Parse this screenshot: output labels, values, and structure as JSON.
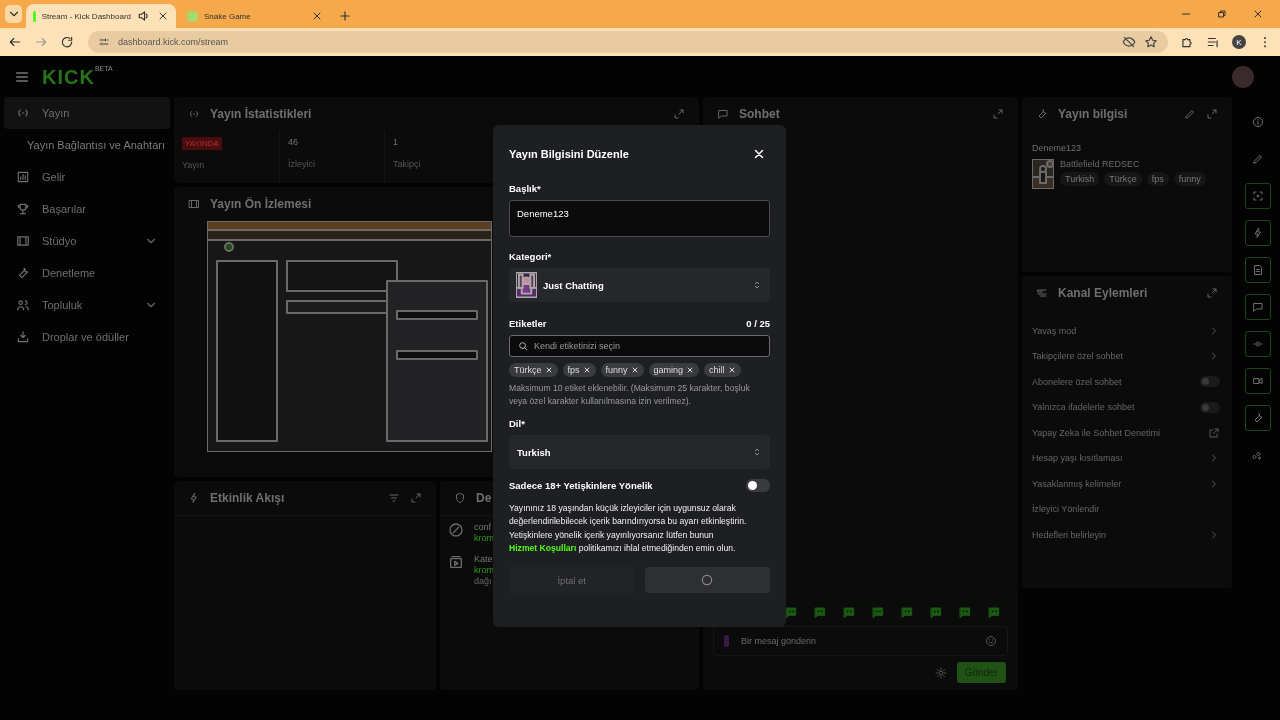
{
  "browser": {
    "tabs": [
      {
        "title": "Stream - Kick Dashboard",
        "selected": true,
        "audio": true
      },
      {
        "title": "Snake Game",
        "selected": false,
        "audio": false
      }
    ],
    "url": "dashboard.kick.com/stream",
    "profile_initial": "K"
  },
  "header": {
    "logo": "KICK",
    "logo_badge": "BETA"
  },
  "sidebar": {
    "items": [
      {
        "label": "Yayın",
        "kind": "link",
        "selected": true
      },
      {
        "label": "Yayın Bağlantısı ve Anahtarı",
        "kind": "sub",
        "selected": false
      },
      {
        "label": "Gelir",
        "kind": "link",
        "selected": false
      },
      {
        "label": "Başarılar",
        "kind": "link",
        "selected": false
      },
      {
        "label": "Stüdyo",
        "kind": "group",
        "selected": false,
        "expanded": false
      },
      {
        "label": "Denetleme",
        "kind": "link",
        "selected": false
      },
      {
        "label": "Topluluk",
        "kind": "group",
        "selected": false,
        "expanded": false
      },
      {
        "label": "Droplar ve ödüller",
        "kind": "link",
        "selected": false
      }
    ]
  },
  "stats": {
    "title": "Yayın İstatistikleri",
    "status": "YAYINDA",
    "status_label": "Yayın",
    "items": [
      {
        "value": "46",
        "label": "İzleyici"
      },
      {
        "value": "1",
        "label": "Takipçi"
      }
    ]
  },
  "preview": {
    "title": "Yayın Ön İzlemesi"
  },
  "activity": {
    "title": "Etkinlik Akışı"
  },
  "recent": {
    "title": "De",
    "events": [
      {
        "title": "conf",
        "user": "krom"
      },
      {
        "title": "Kate",
        "user": "krom",
        "detail": "dağı"
      }
    ]
  },
  "chat": {
    "title": "Sohbet",
    "placeholder": "Bir mesaj gönderin",
    "send": "Gönder"
  },
  "stream_info": {
    "title": "Yayın bilgisi",
    "stream_title": "Deneme123",
    "category": "Battlefield REDSEC",
    "tags": [
      "Turkish",
      "Türkçe",
      "fps",
      "funny"
    ]
  },
  "channel_actions": {
    "title": "Kanal Eylemleri",
    "items": [
      {
        "label": "Yavaş mod",
        "kind": "chevron"
      },
      {
        "label": "Takipçilere özel sohbet",
        "kind": "chevron"
      },
      {
        "label": "Abonelere özel sohbet",
        "kind": "toggle",
        "on": false
      },
      {
        "label": "Yalnızca ifadelerle sohbet",
        "kind": "toggle",
        "on": false
      },
      {
        "label": "Yapay Zeka ile Sohbet Denetimi",
        "kind": "external"
      },
      {
        "label": "Hesap yaşı kısıtlaması",
        "kind": "chevron"
      },
      {
        "label": "Yasaklanmış kelimeler",
        "kind": "chevron"
      },
      {
        "label": "İzleyici Yönlendir",
        "kind": "plain"
      },
      {
        "label": "Hedefleri belirleyin",
        "kind": "chevron"
      }
    ]
  },
  "modal": {
    "title": "Yayın Bilgisini Düzenle",
    "title_label": "Başlık*",
    "title_value": "Deneme123",
    "category_label": "Kategori*",
    "category": "Just Chatting",
    "tags_label": "Etiketler",
    "tags_count": "0 / 25",
    "tags_placeholder": "Kendi etiketinizi seçin",
    "tags": [
      "Türkçe",
      "fps",
      "funny",
      "gaming",
      "chill"
    ],
    "tags_hint": "Maksimum 10 etiket eklenebilir. (Maksimum 25 karakter, boşluk veya özel karakter kullanılmasına izin verilmez).",
    "language_label": "Dil*",
    "language": "Turkish",
    "mature_label": "Sadece 18+ Yetişkinlere Yönelik",
    "mature_on": false,
    "mature_text_before": "Yayınınız 18 yaşından küçük izleyiciler için uygunsuz olarak değerlendirilebilecek içerik barındırıyorsa bu ayarı etkinleştirin. Yetişkinlere yönelik içerik yayınlıyorsanız lütfen bunun ",
    "mature_link": "Hizmet Koşulları",
    "mature_text_after": " politikamızı ihlal etmediğinden emin olun.",
    "cancel": "İptal et",
    "cancel_disabled": true,
    "saving": true
  }
}
